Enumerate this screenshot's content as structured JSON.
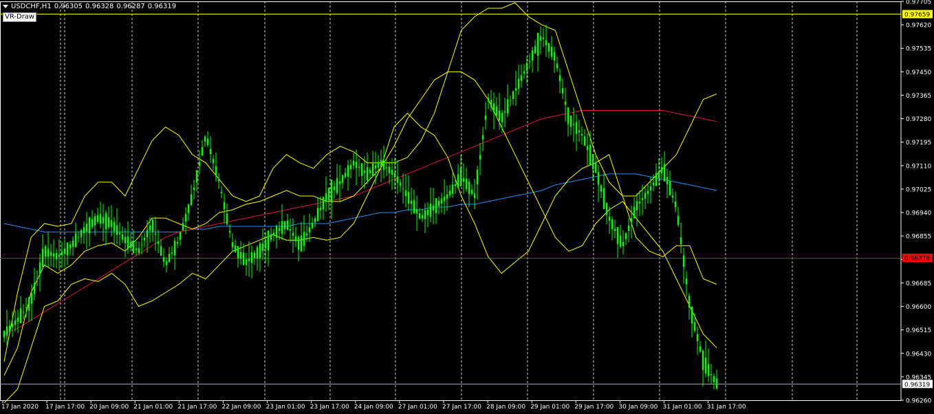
{
  "header": {
    "symbol": "USDCHF,H1",
    "open": "0.96305",
    "high": "0.96328",
    "low": "0.96287",
    "close": "0.96319"
  },
  "buttons": {
    "vr_draw": "VR-Draw"
  },
  "price_axis": {
    "ticks": [
      "0.97705",
      "0.97620",
      "0.97535",
      "0.97450",
      "0.97365",
      "0.97280",
      "0.97195",
      "0.97110",
      "0.97025",
      "0.96940",
      "0.96855",
      "0.96770",
      "0.96685",
      "0.96600",
      "0.96515",
      "0.96430",
      "0.96345",
      "0.96260"
    ],
    "min": 0.9626,
    "max": 0.97705
  },
  "time_axis": {
    "labels": [
      "17 Jan 2020",
      "17 Jan 17:00",
      "20 Jan 09:00",
      "21 Jan 01:00",
      "21 Jan 17:00",
      "22 Jan 09:00",
      "23 Jan 01:00",
      "23 Jan 17:00",
      "24 Jan 09:00",
      "27 Jan 01:00",
      "27 Jan 17:00",
      "28 Jan 09:00",
      "29 Jan 01:00",
      "29 Jan 17:00",
      "30 Jan 09:00",
      "31 Jan 01:00",
      "31 Jan 17:00"
    ]
  },
  "levels": [
    {
      "name": "yellow-level",
      "price": 0.97659,
      "label": "0.97659",
      "color": "#ffff00",
      "label_bg": "#ffff00",
      "label_color": "#000000"
    },
    {
      "name": "red-level",
      "price": 0.96776,
      "label": "0.96776",
      "color": "#ff0000",
      "label_bg": "#ff0000",
      "label_color": "#000000"
    },
    {
      "name": "bid-level",
      "price": 0.96319,
      "label": "0.96319",
      "color": "#9aa0b0",
      "label_bg": "#ffffff",
      "label_color": "#000000"
    }
  ],
  "colors": {
    "background": "#000000",
    "candles": "#00ff00",
    "bollinger": "#ffff00",
    "ma_slow": "#1e90ff",
    "ma_mid": "#dc143c",
    "grid": "#ffffff",
    "axis_text": "#ffffff"
  },
  "chart_data": {
    "type": "line",
    "series": [
      {
        "values": [
          0.965,
          0.9655,
          0.9662,
          0.968,
          0.9678,
          0.9682,
          0.9688,
          0.9692,
          0.969,
          0.9684,
          0.968,
          0.969,
          0.9675,
          0.9684,
          0.97,
          0.9722,
          0.9705,
          0.9682,
          0.9676,
          0.968,
          0.9686,
          0.969,
          0.9682,
          0.969,
          0.97,
          0.9705,
          0.9712,
          0.9708,
          0.9712,
          0.9708,
          0.97,
          0.9692,
          0.9696,
          0.97,
          0.9707,
          0.97,
          0.9735,
          0.9728,
          0.9738,
          0.9748,
          0.9758,
          0.975,
          0.9728,
          0.9722,
          0.971,
          0.9692,
          0.9682,
          0.9696,
          0.9702,
          0.971,
          0.9696,
          0.966,
          0.964,
          0.9632
        ]
      },
      {
        "values": [
          0.965,
          0.9652,
          0.9655,
          0.9658,
          0.9661,
          0.9664,
          0.9667,
          0.967,
          0.9673,
          0.9676,
          0.9679,
          0.9682,
          0.9685,
          0.9687,
          0.9688,
          0.9689,
          0.969,
          0.9691,
          0.9692,
          0.9693,
          0.9694,
          0.9695,
          0.9696,
          0.9697,
          0.9698,
          0.9699,
          0.97,
          0.9702,
          0.9704,
          0.9706,
          0.9708,
          0.971,
          0.9712,
          0.9714,
          0.9716,
          0.9718,
          0.972,
          0.9722,
          0.9724,
          0.9726,
          0.9728,
          0.9729,
          0.973,
          0.9731,
          0.9731,
          0.9731,
          0.9731,
          0.9731,
          0.9731,
          0.9731,
          0.973,
          0.9729,
          0.9728,
          0.9727
        ]
      },
      {
        "values": [
          0.969,
          0.9689,
          0.9688,
          0.9687,
          0.9687,
          0.9687,
          0.9687,
          0.9687,
          0.9687,
          0.9687,
          0.9687,
          0.9687,
          0.9687,
          0.9687,
          0.9688,
          0.9688,
          0.9689,
          0.9689,
          0.9689,
          0.9689,
          0.9689,
          0.9689,
          0.969,
          0.969,
          0.969,
          0.9691,
          0.9692,
          0.9693,
          0.9694,
          0.9694,
          0.9695,
          0.9695,
          0.9696,
          0.9696,
          0.9697,
          0.9697,
          0.9698,
          0.9699,
          0.97,
          0.9701,
          0.9702,
          0.9704,
          0.9705,
          0.9706,
          0.9707,
          0.9708,
          0.9708,
          0.9708,
          0.9707,
          0.9706,
          0.9705,
          0.9704,
          0.9703,
          0.9702
        ]
      },
      {
        "values": [
          0.964,
          0.9665,
          0.9685,
          0.969,
          0.9689,
          0.969,
          0.97,
          0.9705,
          0.9705,
          0.97,
          0.971,
          0.972,
          0.9725,
          0.9722,
          0.9715,
          0.9712,
          0.9706,
          0.97,
          0.9698,
          0.97,
          0.971,
          0.9715,
          0.9712,
          0.971,
          0.9715,
          0.9718,
          0.9716,
          0.9712,
          0.9712,
          0.9712,
          0.9714,
          0.972,
          0.973,
          0.9745,
          0.976,
          0.9765,
          0.9768,
          0.9768,
          0.977,
          0.9765,
          0.9762,
          0.976,
          0.9745,
          0.973,
          0.9715,
          0.9705,
          0.97,
          0.97,
          0.9705,
          0.971,
          0.9715,
          0.9725,
          0.9735,
          0.9737
        ]
      },
      {
        "values": [
          0.9635,
          0.9645,
          0.9665,
          0.9675,
          0.9672,
          0.9675,
          0.968,
          0.9682,
          0.9683,
          0.968,
          0.9685,
          0.9692,
          0.9692,
          0.969,
          0.9688,
          0.969,
          0.9694,
          0.9695,
          0.9697,
          0.9698,
          0.97,
          0.9702,
          0.97,
          0.97,
          0.9698,
          0.9698,
          0.97,
          0.9705,
          0.971,
          0.9718,
          0.9728,
          0.9735,
          0.9742,
          0.9745,
          0.9745,
          0.9742,
          0.9735,
          0.9725,
          0.9715,
          0.9705,
          0.9695,
          0.9685,
          0.968,
          0.9682,
          0.969,
          0.9695,
          0.9698,
          0.9692,
          0.9686,
          0.968,
          0.967,
          0.966,
          0.965,
          0.9645
        ]
      },
      {
        "values": [
          0.9625,
          0.963,
          0.9645,
          0.966,
          0.9662,
          0.9668,
          0.967,
          0.9669,
          0.9672,
          0.9668,
          0.966,
          0.9662,
          0.9665,
          0.9668,
          0.9672,
          0.967,
          0.9675,
          0.968,
          0.9682,
          0.9684,
          0.9686,
          0.9684,
          0.9684,
          0.9685,
          0.9684,
          0.9685,
          0.969,
          0.97,
          0.971,
          0.9725,
          0.973,
          0.9725,
          0.9722,
          0.9714,
          0.97,
          0.969,
          0.9678,
          0.9672,
          0.9676,
          0.968,
          0.969,
          0.97,
          0.9706,
          0.971,
          0.9712,
          0.9715,
          0.97,
          0.9685,
          0.968,
          0.9678,
          0.9682,
          0.9682,
          0.967,
          0.9668
        ]
      }
    ]
  }
}
